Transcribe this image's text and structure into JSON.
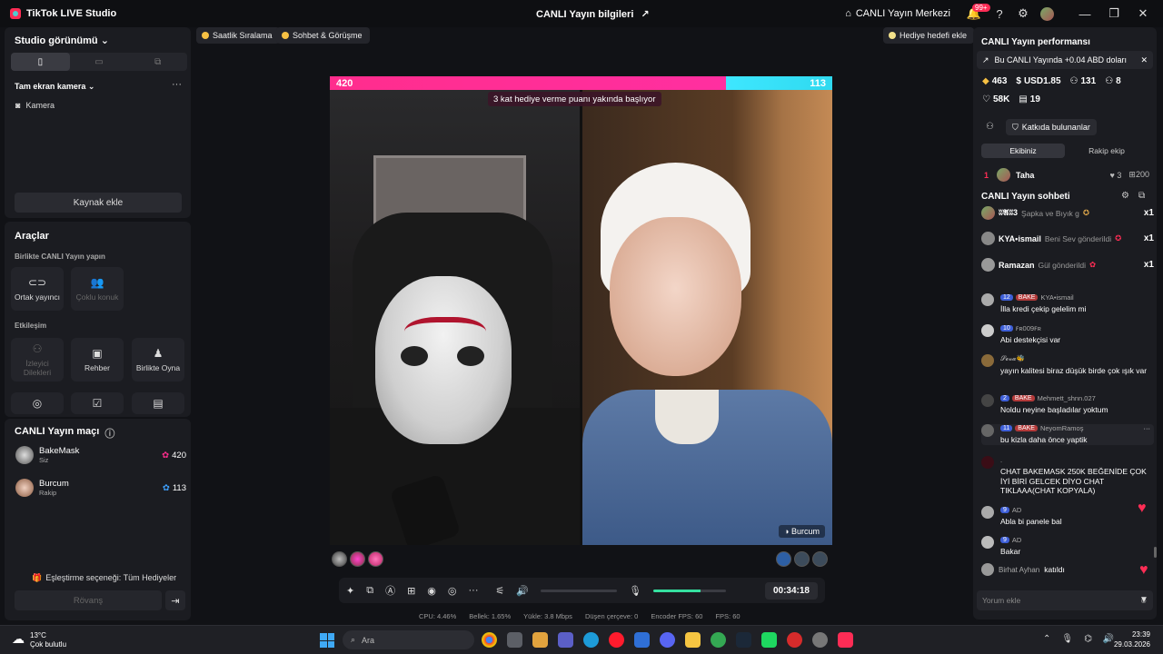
{
  "titlebar": {
    "app_name": "TikTok LIVE Studio",
    "center_title": "CANLI Yayın bilgileri",
    "center_button": "CANLI Yayın Merkezi",
    "notif_badge": "99+"
  },
  "left": {
    "studio_view": "Studio görünümü",
    "source_header": "Tam ekran kamera",
    "source_item": "Kamera",
    "add_source": "Kaynak ekle",
    "tools_title": "Araçlar",
    "collab_title": "Birlikte CANLI Yayın yapın",
    "tools_collab": [
      {
        "label": "Ortak yayıncı",
        "icon": "link-icon"
      },
      {
        "label": "Çoklu konuk",
        "icon": "multi-guest-icon"
      }
    ],
    "interaction_title": "Etkileşim",
    "tools_interaction": [
      {
        "label": "İzleyici Dilekleri",
        "icon": "wishes-icon"
      },
      {
        "label": "Rehber",
        "icon": "guide-icon"
      },
      {
        "label": "Birlikte Oyna",
        "icon": "play-together-icon"
      }
    ],
    "match_title": "CANLI Yayın maçı",
    "match": [
      {
        "name": "BakeMask",
        "sub": "Siz",
        "score": "420",
        "color": "#ff2d8d"
      },
      {
        "name": "Burcum",
        "sub": "Rakip",
        "score": "113",
        "color": "#3ee7ff"
      }
    ],
    "match_option": "Eşleştirme seçeneği: Tüm Hediyeler",
    "rematch": "Rövanş"
  },
  "center": {
    "chip_ranking": "Saatlik Sıralama",
    "chip_chat": "Sohbet & Görüşme",
    "chip_gift_goal": "Hediye hedefi ekle",
    "score_left": "420",
    "score_right": "113",
    "banner": "3 kat hediye verme puanı yakında başlıyor",
    "opponent_tag": "Burcum",
    "timer": "00:34:18",
    "stats": {
      "cpu": "CPU: 4.46%",
      "mem": "Bellek: 1.65%",
      "upload": "Yükle: 3.8 Mbps",
      "dropped": "Düşen çerçeve: 0",
      "encoder": "Encoder FPS: 60",
      "fps": "FPS: 60"
    }
  },
  "right": {
    "perf_title": "CANLI Yayın performansı",
    "earnings": "Bu CANLI Yayında +0.04 ABD doları",
    "stat_diamonds": "463",
    "stat_usd": "USD1.85",
    "stat_viewers": "131",
    "stat_gifters": "8",
    "stat_likes": "58K",
    "stat_followers": "19",
    "contributors_btn": "Katkıda bulunanlar",
    "tab_team": "Ekibiniz",
    "tab_rival": "Rakip ekip",
    "rank": {
      "pos": "1",
      "name": "Taha",
      "gifts": "3",
      "points": "200"
    },
    "chat_title": "CANLI Yayın sohbeti",
    "gifts": [
      {
        "name": "ʬ𝕬ʬ3",
        "text": "Şapka ve Bıyık g",
        "count": "x1"
      },
      {
        "name": "KYA•ismail",
        "text": "Beni Sev gönderildi",
        "count": "x1"
      },
      {
        "name": "Ramazan",
        "text": "Gül gönderildi",
        "count": "x1"
      }
    ],
    "messages": [
      {
        "level": "12",
        "fan": "BAKE",
        "user": "KYA•ismail",
        "text": "İlla kredi çekip gelelim mi"
      },
      {
        "level": "10",
        "fan": "",
        "user": "ꜰʀ009ꜰʀ",
        "text": "Abi destekçisi var"
      },
      {
        "level": "",
        "fan": "",
        "user": "𝓢𝓮𝓿𝓪🐝",
        "text": "yayın kalitesi biraz düşük birde çok ışık var"
      },
      {
        "level": "2",
        "fan": "BAKE",
        "user": "Mehmett_shnn.027",
        "text": "Noldu neyine başladılar yoktum"
      },
      {
        "level": "11",
        "fan": "BAKE",
        "user": "NeyomRamoş",
        "text": "bu kizla daha önce yaptik"
      },
      {
        "level": "",
        "fan": "",
        "user": ".",
        "text": "CHAT BAKEMASK 250K BEĞENİDE ÇOK İYİ BİRİ GELCEK DİYO CHAT TIKLAAA(CHAT KOPYALA)"
      },
      {
        "level": "9",
        "fan": "",
        "user": "AD",
        "text": "Abla bi panele bal"
      },
      {
        "level": "9",
        "fan": "",
        "user": "AD",
        "text": "Bakar"
      }
    ],
    "join": {
      "user": "Birhat Ayhan",
      "text": "katıldı"
    },
    "comment_placeholder": "Yorum ekle"
  },
  "taskbar": {
    "temp": "13°C",
    "weather": "Çok bulutlu",
    "search": "Ara",
    "time": "23:39",
    "date": "29.03.2026"
  },
  "colors": {
    "accent_pink": "#ff2d8d",
    "accent_cyan": "#3ee7ff",
    "bg": "#111216",
    "panel": "#1b1c21"
  }
}
